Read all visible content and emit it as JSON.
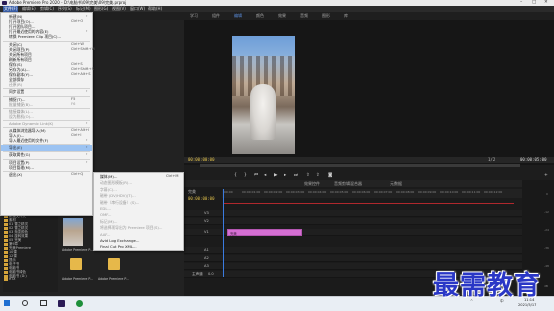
{
  "window": {
    "title": "Adobe Premiere Pro 2020 - D:\\电脑书\\09\\完美\\09\\完美.prproj",
    "controls": [
      "–",
      "□",
      "✕"
    ]
  },
  "menubar": {
    "items": [
      "文件(F)",
      "编辑(E)",
      "剪辑(C)",
      "序列(S)",
      "标记(M)",
      "图形(G)",
      "视图(V)",
      "窗口(W)",
      "帮助(H)"
    ]
  },
  "workspace_tabs": [
    "学习",
    "组件",
    "编辑",
    "颜色",
    "效果",
    "音频",
    "图形",
    "库"
  ],
  "monitor": {
    "timecode_left": "00:00:00:00",
    "fit": "1/2",
    "timecode_right": "00:00:05:00"
  },
  "timeline": {
    "tabs": [
      "效果控件",
      "音频剪辑混合器",
      "元数据"
    ],
    "sequence_tab": "完美",
    "timecode": "00:00:00:00",
    "ruler_ticks": [
      "00:00",
      "00:00:01:00",
      "00:00:02:00",
      "00:00:03:00",
      "00:00:04:00",
      "00:00:05:00",
      "00:00:06:00",
      "00:00:07:00",
      "00:00:08:00",
      "00:00:09:00",
      "00:00:10:00",
      "00:00:11:00",
      "00:00:12:00",
      "00:00:13:00"
    ],
    "tracks_video": [
      "V3",
      "V2",
      "V1"
    ],
    "tracks_audio": [
      "A1",
      "A2",
      "A3"
    ],
    "master_label": "主声道",
    "master_value": "0.0",
    "clip_label": "完美"
  },
  "meters": {
    "labels": [
      "0",
      "-12",
      "-24",
      "-36",
      "-48",
      "dB"
    ]
  },
  "project": {
    "tree": [
      "新建文件夹",
      "素材",
      "01 雪之精灵",
      "02 雪之精灵",
      "03 渐变颜色",
      "04 旋转效果",
      "05 完美",
      "第9章",
      "完美Premiere",
      "10课",
      "12课",
      "提示",
      "电子书",
      "电脑书",
      "电脑书绿色",
      "电脑书 (D:)",
      "RTX"
    ],
    "thumbnails": [
      {
        "label": "Adobe Premiere P..."
      },
      {
        "label": "Adobe Premiere P..."
      },
      {
        "label": "Adobe Premiere P..."
      },
      {
        "label": "Adobe Premiere P..."
      }
    ]
  },
  "file_menu": {
    "items": [
      {
        "label": "新建(N)",
        "shortcut": "",
        "arrow": true,
        "disabled": false
      },
      {
        "label": "打开项目(O)...",
        "shortcut": "Ctrl+O",
        "arrow": false,
        "disabled": false
      },
      {
        "label": "打开团队项目...",
        "shortcut": "",
        "arrow": false,
        "disabled": false
      },
      {
        "label": "打开最近使用的内容(E)",
        "shortcut": "",
        "arrow": true,
        "disabled": false
      },
      {
        "label": "转换 Premiere Clip 项目(C)...",
        "shortcut": "",
        "arrow": false,
        "disabled": false
      },
      {
        "sep": true
      },
      {
        "label": "关闭(C)",
        "shortcut": "Ctrl+W",
        "arrow": false,
        "disabled": false
      },
      {
        "label": "关闭项目(P)",
        "shortcut": "Ctrl+Shift+W",
        "arrow": false,
        "disabled": false
      },
      {
        "label": "关闭所有项目",
        "shortcut": "",
        "arrow": false,
        "disabled": false
      },
      {
        "label": "刷新所有项目",
        "shortcut": "",
        "arrow": false,
        "disabled": false
      },
      {
        "label": "保存(S)",
        "shortcut": "Ctrl+S",
        "arrow": false,
        "disabled": false
      },
      {
        "label": "另存为(A)...",
        "shortcut": "Ctrl+Shift+S",
        "arrow": false,
        "disabled": false
      },
      {
        "label": "保存副本(Y)...",
        "shortcut": "Ctrl+Alt+S",
        "arrow": false,
        "disabled": false
      },
      {
        "label": "全部保存",
        "shortcut": "",
        "arrow": false,
        "disabled": false
      },
      {
        "label": "还原(R)",
        "shortcut": "",
        "arrow": false,
        "disabled": true
      },
      {
        "sep": true
      },
      {
        "label": "同步设置",
        "shortcut": "",
        "arrow": true,
        "disabled": false
      },
      {
        "sep": true
      },
      {
        "label": "捕捉(T)...",
        "shortcut": "F5",
        "arrow": false,
        "disabled": false
      },
      {
        "label": "批量捕捉(B)...",
        "shortcut": "F6",
        "arrow": false,
        "disabled": true
      },
      {
        "sep": true
      },
      {
        "label": "链接媒体(L)...",
        "shortcut": "",
        "arrow": false,
        "disabled": true
      },
      {
        "label": "设为脱机(O)...",
        "shortcut": "",
        "arrow": false,
        "disabled": true
      },
      {
        "sep": true
      },
      {
        "label": "Adobe Dynamic Link(K)",
        "shortcut": "",
        "arrow": true,
        "disabled": true
      },
      {
        "sep": true
      },
      {
        "label": "从媒体浏览器导入(M)",
        "shortcut": "Ctrl+Alt+I",
        "arrow": false,
        "disabled": false
      },
      {
        "label": "导入(I)...",
        "shortcut": "Ctrl+I",
        "arrow": false,
        "disabled": false
      },
      {
        "label": "导入最近使用的文件(F)",
        "shortcut": "",
        "arrow": true,
        "disabled": false
      },
      {
        "sep": true
      },
      {
        "label": "导出(E)",
        "shortcut": "",
        "arrow": true,
        "disabled": false,
        "highlighted": true
      },
      {
        "sep": true
      },
      {
        "label": "获取属性(G)",
        "shortcut": "",
        "arrow": true,
        "disabled": false
      },
      {
        "sep": true
      },
      {
        "label": "项目设置(P)",
        "shortcut": "",
        "arrow": true,
        "disabled": false
      },
      {
        "label": "项目管理(M)...",
        "shortcut": "",
        "arrow": false,
        "disabled": false
      },
      {
        "sep": true
      },
      {
        "label": "退出(X)",
        "shortcut": "Ctrl+Q",
        "arrow": false,
        "disabled": false
      }
    ]
  },
  "export_submenu": {
    "items": [
      {
        "label": "媒体(M)...",
        "shortcut": "Ctrl+M",
        "disabled": false
      },
      {
        "label": "动态图形模板(R)...",
        "shortcut": "",
        "disabled": true
      },
      {
        "label": "字幕(C)...",
        "shortcut": "",
        "disabled": true
      },
      {
        "label": "磁带 (DV/HDV)(T)...",
        "shortcut": "",
        "disabled": true
      },
      {
        "label": "磁带（串行设备）(S)...",
        "shortcut": "",
        "disabled": true
      },
      {
        "label": "EDL...",
        "shortcut": "",
        "disabled": true
      },
      {
        "label": "OMF...",
        "shortcut": "",
        "disabled": true
      },
      {
        "label": "标记(M)...",
        "shortcut": "",
        "disabled": true
      },
      {
        "label": "将选择项导出为 Premiere 项目(S)...",
        "shortcut": "",
        "disabled": true
      },
      {
        "label": "AAF...",
        "shortcut": "",
        "disabled": true
      },
      {
        "label": "Avid Log Exchange...",
        "shortcut": "",
        "disabled": false
      },
      {
        "label": "Final Cut Pro XML...",
        "shortcut": "",
        "disabled": false
      }
    ]
  },
  "taskbar": {
    "time": "11:14",
    "date": "2021/5/17",
    "lang": "中",
    "tray_label": "^"
  },
  "watermark": "最需教育"
}
